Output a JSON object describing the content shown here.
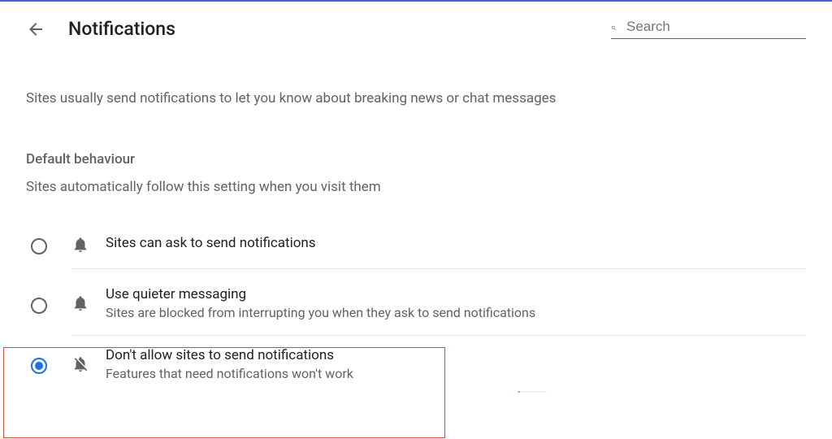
{
  "header": {
    "title": "Notifications",
    "search_placeholder": "Search"
  },
  "description": "Sites usually send notifications to let you know about breaking news or chat messages",
  "section": {
    "title": "Default behaviour",
    "subtitle": "Sites automatically follow this setting when you visit them"
  },
  "options": [
    {
      "label": "Sites can ask to send notifications",
      "sub": "",
      "selected": false,
      "icon": "bell"
    },
    {
      "label": "Use quieter messaging",
      "sub": "Sites are blocked from interrupting you when they ask to send notifications",
      "selected": false,
      "icon": "bell"
    },
    {
      "label": "Don't allow sites to send notifications",
      "sub": "Features that need notifications won't work",
      "selected": true,
      "icon": "bell-off"
    }
  ]
}
